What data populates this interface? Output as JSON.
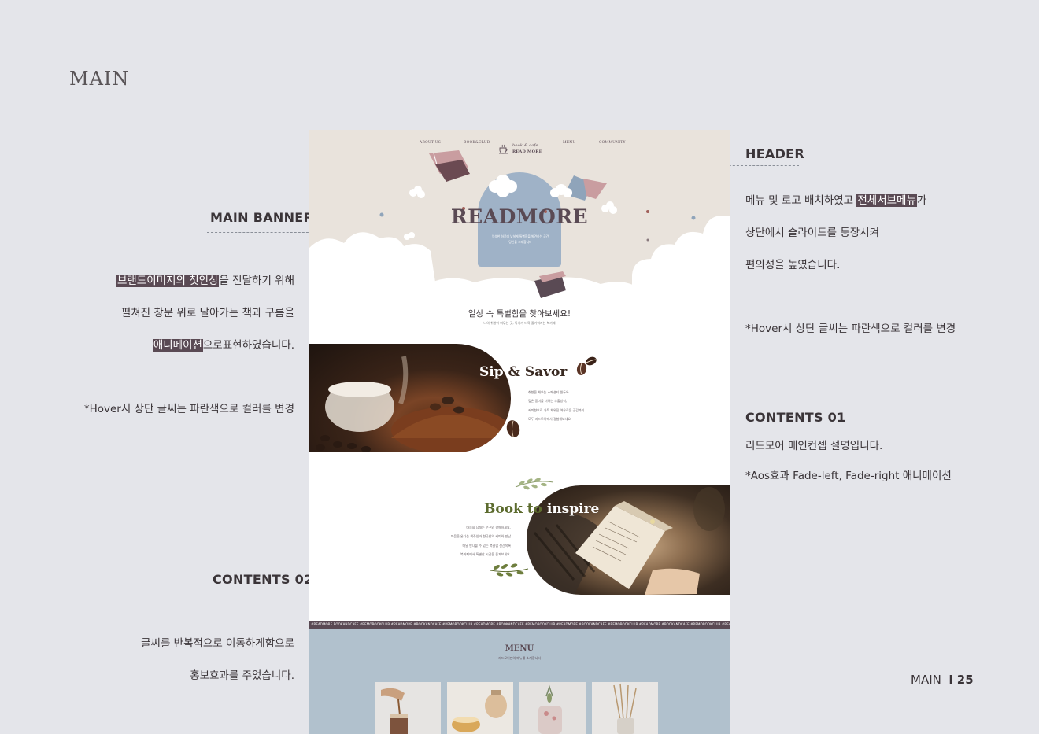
{
  "page": {
    "title": "MAIN",
    "footer_section": "MAIN",
    "footer_divider": "I",
    "footer_page": "25"
  },
  "notes": {
    "main_banner": {
      "title": "MAIN BANNER",
      "line1_highlight": "브랜드이미지의 첫인상",
      "line1_rest": "을 전달하기 위해",
      "line2": "펼쳐진 창문 위로 날아가는 책과 구름을",
      "line3_highlight": "애니메이션",
      "line3_rest": "으로표현하였습니다.",
      "hover": "*Hover시 상단 글씨는 파란색으로 컬러를 변경"
    },
    "header": {
      "title": "HEADER",
      "line1_start": "메뉴 및 로고 배치하였고 ",
      "line1_highlight": "전체서브메뉴",
      "line1_end": "가",
      "line2": "상단에서 슬라이드를 등장시켜",
      "line3": "편의성을 높였습니다.",
      "hover": "*Hover시 상단 글씨는 파란색으로 컬러를 변경"
    },
    "contents01": {
      "title": "CONTENTS 01",
      "line1": "리드모어 메인컨셉 설명입니다.",
      "line2": "*Aos효과  Fade-left, Fade-right 애니메이션"
    },
    "contents02": {
      "title": "CONTENTS 02",
      "line1": "글씨를 반복적으로 이동하게함으로",
      "line2": "홍보효과를 주었습니다."
    }
  },
  "mockup": {
    "nav": {
      "about": "ABOUT US",
      "bookclub": "BOOK&CLUB",
      "logo_top": "book & cafe",
      "logo_bottom": "READ MORE",
      "menu": "MENU",
      "community": "COMMUNITY"
    },
    "hero": {
      "word": "READMORE",
      "sub": "익숙한 하루에 낯설게 특별함을 발견하는 공간\n당신을 초대합니다"
    },
    "tagline": "일상 속 특별함을 찾아보세요!",
    "tagline_sub": "나의 취향이 머무는 곳, 독서가 더욱 즐거워지는 북카페",
    "sip": {
      "title_white": "Sip ",
      "title_dark": "& Savor",
      "text": "취향을 채우는 스페셜티 원두와\n깊은 풍미를 더하는 추출방식,\n커피향으로 가득 채워진 여유로운 공간까지\n모두 리드모어에서 경험해보세요."
    },
    "book": {
      "title_green": "Book to",
      "title_white": " inspire",
      "text": "마음을 담래는 문구와 함께하세요.\n마음을 온다는 책주인과 향긋한의 커피와 만남\n매달 만나볼 수 있는 북클럽 신간목록\n북카페에서 특별한 시간을 즐겨보세요."
    },
    "marquee": "#READMORE   BOOKANDCAFE   #REMOBOOKCLUB   #READMORE   #BOOKANDCAFE   #REMOBOOKCLUB   #READMORE   #BOOKANDCAFE   #REMOBOOKCLUB   #READMORE   #BOOKANDCAFE   #REMOBOOKCLUB   #READMORE   #BOOKANDCAFE   #REMOBOOKCLUB   #READMORE   #BOOKANDCAFE   #REMOBOOKCLUB",
    "menu_section": {
      "title": "MENU",
      "sub": "리드모어만의 메뉴를 소개합니다"
    },
    "colors": {
      "brand": "#5a4a54",
      "sky": "#9fb2c7",
      "hero_bg": "#e9e3dc",
      "menu_bg": "#b1c1cd",
      "olive": "#5c6b2e"
    }
  }
}
